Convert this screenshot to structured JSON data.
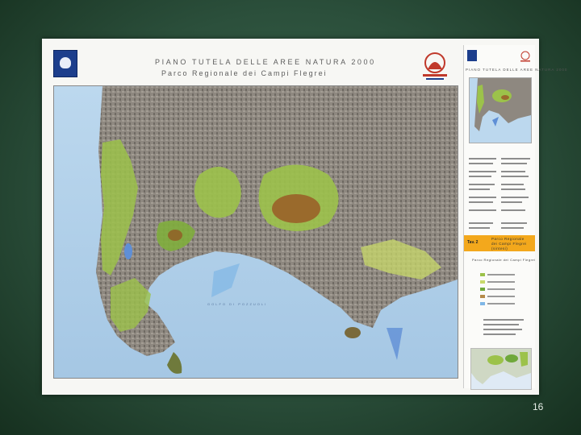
{
  "slide": {
    "page_number": "16",
    "background_color": "#2b4f3b"
  },
  "map_sheet": {
    "header_title": "PIANO TUTELA DELLE AREE NATURA 2000",
    "header_subtitle": "Parco Regionale dei Campi Flegrei",
    "sea_label": "GOLFO DI POZZUOLI",
    "colors": {
      "sea": "#a9cbe6",
      "urban": "#8f8a82",
      "park_green": "#9cc24a",
      "crater_brown": "#9a6a2c",
      "lake_blue": "#5f8fd6"
    }
  },
  "legend_panel": {
    "title": "PIANO TUTELA DELLE AREE NATURA 2000",
    "tav_label": "Tav. 2",
    "tav_title_line1": "Parco Regionale",
    "tav_title_line2": "dei Campi Flegrei (sintesi)",
    "legend_heading": "Parco Regionale dei Campi Flegrei",
    "legend_items": [
      {
        "color": "#9cc24a"
      },
      {
        "color": "#c8d96a"
      },
      {
        "color": "#6fa83a"
      },
      {
        "color": "#b58b4a"
      },
      {
        "color": "#7fb7e6"
      }
    ],
    "accent_color": "#f3a81c"
  }
}
